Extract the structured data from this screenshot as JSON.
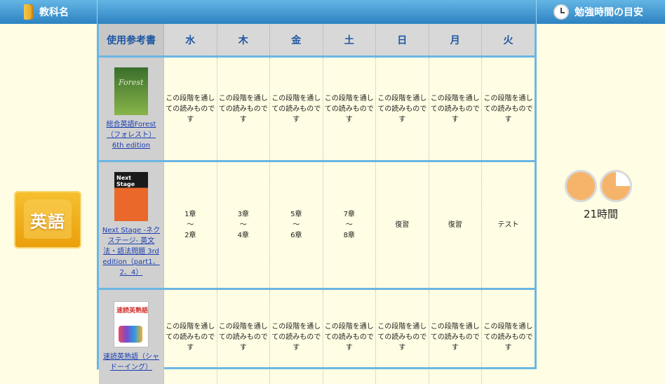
{
  "header": {
    "subject_header": "教科名",
    "folder_icon": "folder-icon",
    "time_header": "勉強時間の目安",
    "clock_icon": "clock-icon"
  },
  "subject": {
    "label": "英語",
    "icon": "book-icon"
  },
  "table": {
    "book_column_header": "使用参考書",
    "days": [
      "水",
      "木",
      "金",
      "土",
      "日",
      "月",
      "火"
    ],
    "rows": [
      {
        "book_title": "総合英語Forest（フォレスト） 6th edition",
        "cover_text": "Forest",
        "cells": [
          "この段階を通しての読みものです",
          "この段階を通しての読みものです",
          "この段階を通しての読みものです",
          "この段階を通しての読みものです",
          "この段階を通しての読みものです",
          "この段階を通しての読みものです",
          "この段階を通しての読みものです"
        ]
      },
      {
        "book_title": "Next Stage -ネクステージ- 英文法・語法問題 3rd edition（part1、2、4）",
        "cover_text": "Next Stage",
        "cells": [
          "1章\n〜\n2章",
          "3章\n〜\n4章",
          "5章\n〜\n6章",
          "7章\n〜\n8章",
          "復習",
          "復習",
          "テスト"
        ]
      },
      {
        "book_title": "速読英熟語（シャドーイング）",
        "cover_text": "速読英熟語",
        "cells": [
          "この段階を通しての読みものです",
          "この段階を通しての読みものです",
          "この段階を通しての読みものです",
          "この段階を通しての読みものです",
          "この段階を通しての読みものです",
          "この段階を通しての読みものです",
          "この段階を通しての読みものです"
        ]
      }
    ]
  },
  "study_time": {
    "label": "21時間",
    "full_clocks": 1,
    "partial_clock_fraction": 0.75
  }
}
